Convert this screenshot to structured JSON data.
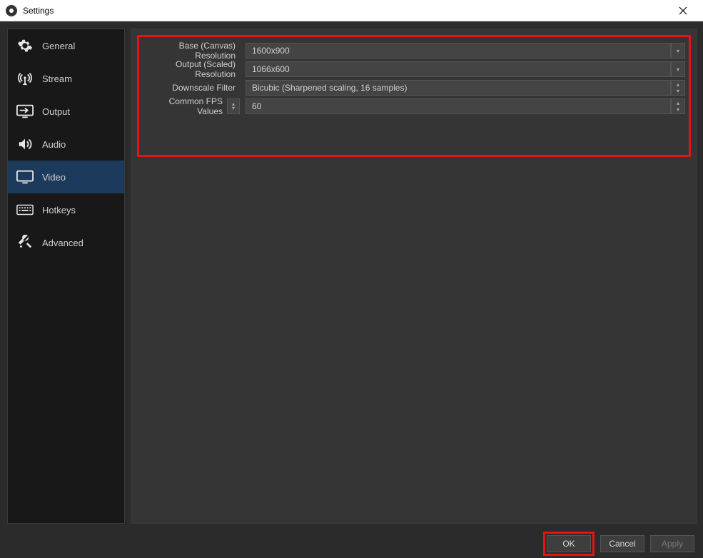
{
  "window": {
    "title": "Settings"
  },
  "sidebar": {
    "items": [
      {
        "label": "General"
      },
      {
        "label": "Stream"
      },
      {
        "label": "Output"
      },
      {
        "label": "Audio"
      },
      {
        "label": "Video"
      },
      {
        "label": "Hotkeys"
      },
      {
        "label": "Advanced"
      }
    ]
  },
  "form": {
    "base_label": "Base (Canvas) Resolution",
    "base_value": "1600x900",
    "output_label": "Output (Scaled) Resolution",
    "output_value": "1066x600",
    "downscale_label": "Downscale Filter",
    "downscale_value": "Bicubic (Sharpened scaling, 16 samples)",
    "fps_label": "Common FPS Values",
    "fps_value": "60"
  },
  "buttons": {
    "ok": "OK",
    "cancel": "Cancel",
    "apply": "Apply"
  }
}
